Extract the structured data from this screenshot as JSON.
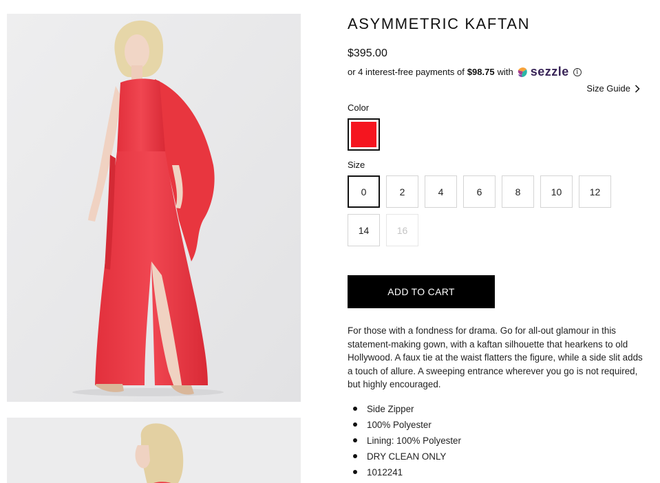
{
  "product": {
    "title": "ASYMMETRIC KAFTAN",
    "price": "$395.00",
    "installments": {
      "prefix": "or 4 interest-free payments of",
      "amount": "$98.75",
      "suffix": "with",
      "provider": "sezzle",
      "info_icon": "info-icon"
    },
    "size_guide": {
      "label": "Size Guide",
      "icon": "chevron-right-icon"
    },
    "color": {
      "label": "Color",
      "selected": "red",
      "swatch_hex": "#f5151f"
    },
    "size": {
      "label": "Size",
      "options": [
        {
          "label": "0",
          "state": "selected"
        },
        {
          "label": "2",
          "state": "available"
        },
        {
          "label": "4",
          "state": "available"
        },
        {
          "label": "6",
          "state": "available"
        },
        {
          "label": "8",
          "state": "available"
        },
        {
          "label": "10",
          "state": "available"
        },
        {
          "label": "12",
          "state": "available"
        },
        {
          "label": "14",
          "state": "available"
        },
        {
          "label": "16",
          "state": "unavailable"
        }
      ]
    },
    "add_to_cart": "ADD TO CART",
    "description": "For those with a fondness for drama. Go for all-out glamour in this statement-making gown, with a kaftan silhouette that hearkens to old Hollywood. A faux tie at the waist flatters the figure, while a side slit adds a touch of allure. A sweeping entrance wherever you go is not required, but highly encouraged.",
    "features": [
      "Side Zipper",
      "100% Polyester",
      "Lining: 100% Polyester",
      "DRY CLEAN ONLY",
      "1012241"
    ]
  },
  "colors": {
    "dress": "#ee3a45",
    "photo_bg": "#e9e9ea",
    "accent": "#000000",
    "sezzle_text": "#392558"
  }
}
